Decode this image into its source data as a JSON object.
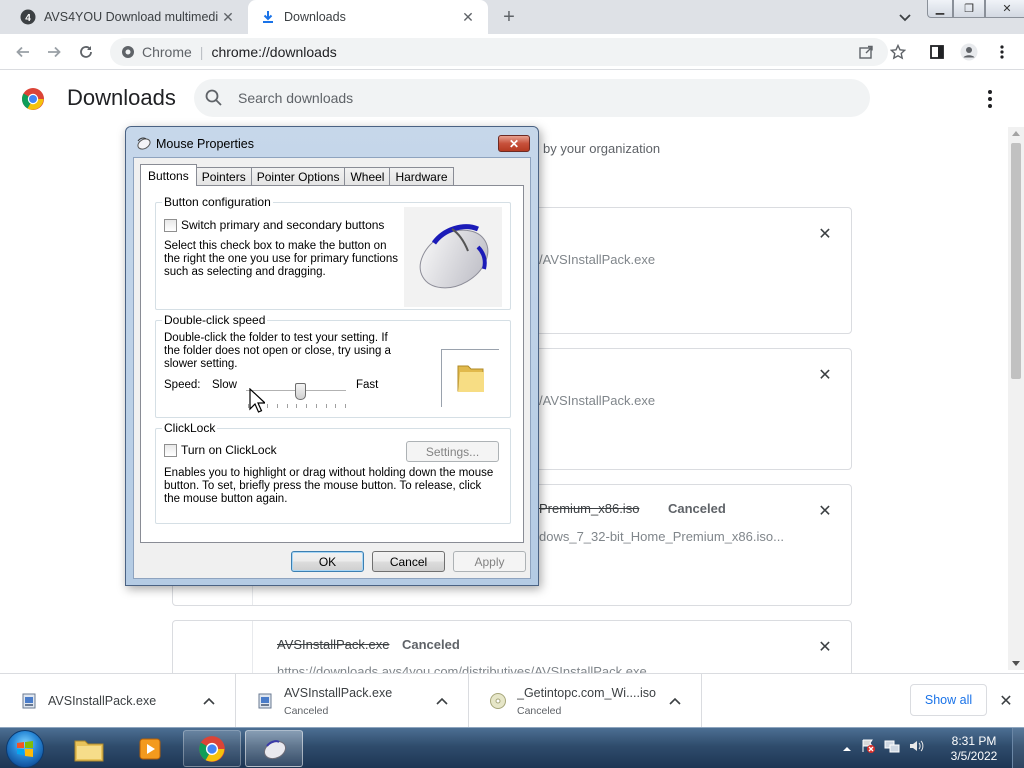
{
  "browser": {
    "tabs": [
      {
        "title": "AVS4YOU Download multimedia",
        "active": false,
        "favicon": "avs4you-icon"
      },
      {
        "title": "Downloads",
        "active": true,
        "favicon": "download-icon"
      }
    ],
    "omnibox": {
      "scheme": "Chrome",
      "url": "chrome://downloads"
    }
  },
  "downloads": {
    "title": "Downloads",
    "search_placeholder": "Search downloads",
    "managed_text": "by your organization",
    "items": [
      {
        "filename": "",
        "status": "",
        "url": "/AVSInstallPack.exe"
      },
      {
        "filename": "",
        "status": "",
        "url": "/AVSInstallPack.exe"
      },
      {
        "filename": "Premium_x86.iso",
        "status": "Canceled",
        "url": "dows_7_32-bit_Home_Premium_x86.iso..."
      },
      {
        "filename": "AVSInstallPack.exe",
        "status": "Canceled",
        "url": "https://downloads.avs4you.com/distributives/AVSInstallPack.exe"
      }
    ]
  },
  "shelf": {
    "items": [
      {
        "name": "AVSInstallPack.exe",
        "status": ""
      },
      {
        "name": "AVSInstallPack.exe",
        "status": "Canceled"
      },
      {
        "name": "_Getintopc.com_Wi....iso",
        "status": "Canceled"
      }
    ],
    "show_all": "Show all"
  },
  "dialog": {
    "title": "Mouse Properties",
    "tabs": [
      "Buttons",
      "Pointers",
      "Pointer Options",
      "Wheel",
      "Hardware"
    ],
    "selected_tab": "Buttons",
    "button_config": {
      "legend": "Button configuration",
      "checkbox_label": "Switch primary and secondary buttons",
      "checked": false,
      "description": "Select this check box to make the button on the right the one you use for primary functions such as selecting and dragging."
    },
    "double_click": {
      "legend": "Double-click speed",
      "description": "Double-click the folder to test your setting. If the folder does not open or close, try using a slower setting.",
      "speed_label": "Speed:",
      "slow_label": "Slow",
      "fast_label": "Fast",
      "slider_value": 0.55
    },
    "clicklock": {
      "legend": "ClickLock",
      "checkbox_label": "Turn on ClickLock",
      "checked": false,
      "settings_button": "Settings...",
      "description": "Enables you to highlight or drag without holding down the mouse button. To set, briefly press the mouse button. To release, click the mouse button again."
    },
    "buttons": {
      "ok": "OK",
      "cancel": "Cancel",
      "apply": "Apply"
    }
  },
  "taskbar": {
    "time": "8:31 PM",
    "date": "3/5/2022"
  },
  "colors": {
    "accent": "#1a73e8",
    "taskbar": "#2f4c6c",
    "dialog_frame": "#b9cfe7"
  }
}
